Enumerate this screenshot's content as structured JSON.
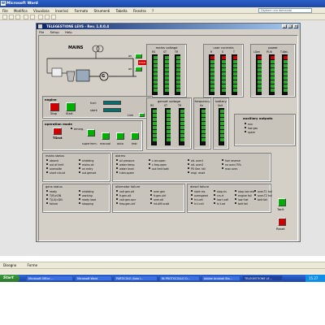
{
  "word": {
    "title": "Microsoft Word",
    "menu": [
      "File",
      "Modifica",
      "Visualizza",
      "Inserisci",
      "Formato",
      "Strumenti",
      "Tabella",
      "Finestra",
      "?"
    ],
    "help_placeholder": "Digitare una domanda",
    "draw_label": "Disegno",
    "forme_label": "Forme"
  },
  "app": {
    "title": "TELEGESTIONE LEVS - Rev. 1.0.0.4",
    "menu": [
      "File",
      "Setup",
      "Help"
    ],
    "mains_label": "MAINS",
    "mains_on": "on",
    "gen_on": "on",
    "load_label": "LOAD",
    "gen_symbol": "G",
    "mains_voltage": {
      "title": "mains voltage",
      "cols": [
        "RS",
        "ST",
        "TR"
      ]
    },
    "user_currents": {
      "title": "user currents",
      "cols": [
        "R",
        "S",
        "T"
      ]
    },
    "power": {
      "title": "power",
      "cols": [
        "LGen",
        "P.Utl",
        "T.Wat."
      ]
    },
    "genset_voltage": {
      "title": "genset voltage",
      "cols": [
        "RS",
        "ST",
        "TR"
      ]
    },
    "frequency": {
      "title": "frequency",
      "cols": [
        "Hz"
      ]
    },
    "battery": {
      "title": "battery",
      "cols": [
        "Volt"
      ]
    },
    "engine": {
      "title": "engine",
      "stop": "Stop",
      "start": "Start",
      "fuel": "fuel:",
      "start_count": "start:",
      "link": "Link"
    },
    "operation_mode": {
      "title": "operation mode",
      "labels": [
        "TGext",
        "emerg.",
        "superimm.",
        "manual",
        "auto",
        "test"
      ]
    },
    "auxiliary": {
      "title": "auxiliary outputs",
      "items": [
        "aux",
        "low gas",
        "spare"
      ]
    },
    "mains_status": {
      "title": "mains status",
      "items": [
        "absent",
        "out of limit",
        "overvolte",
        "short circuit",
        "shielding",
        "mains ok",
        "on entry",
        "out genset"
      ]
    },
    "alarms": {
      "title": "alarms",
      "items": [
        "oil pressure",
        "water temp.",
        "water level",
        "t.dev.spare",
        "c.rev.open",
        "c.frep.open",
        "out limit batt"
      ]
    },
    "alarms_col3": [
      "alt. over1",
      "alt. over2",
      "PX See. fail",
      "engi. reset"
    ],
    "alarms_col4": [
      "fuel reserve",
      "no over.75%",
      "max over."
    ],
    "gens_status": {
      "title": "gens status",
      "items": [
        "ready",
        "T(R)>DN",
        "T(L0)>DN",
        "failure",
        "shielding",
        "working",
        "ready load",
        "stopping"
      ]
    },
    "alternator_failure": {
      "title": "alternator failure",
      "items": [
        "volt gen.alt",
        "fr.gen.alt",
        "volt gen.sscr",
        "freq.gen.uhf",
        "over gen",
        "fr.gen.uhf",
        "over.alt",
        "int.diff.scatt"
      ]
    },
    "diesel_failure": {
      "title": "diesel failure",
      "items": [
        "start res.",
        "overspeed",
        "fr.t.cell",
        "hi t.cell",
        "stop.ris",
        "crs.rt",
        "low t.cell",
        "hi t.wt",
        "stop not rest",
        "engine fail",
        "low fuel",
        "belt fail",
        "over.T1 fail",
        "over.T2 fail",
        "belt fail"
      ]
    },
    "reset": {
      "tacit": "Tacit",
      "reset": "Reset"
    }
  },
  "taskbar": {
    "start": "Start",
    "tasks": [
      "Microsoft Office ...",
      "Microsoft Word",
      "PARTICOLE (Sola l...",
      "IN PROTOCOLLO O...",
      "Adobe Acrobat Sta...",
      "TELEGESTIONE LE..."
    ],
    "clock": "15.27"
  }
}
